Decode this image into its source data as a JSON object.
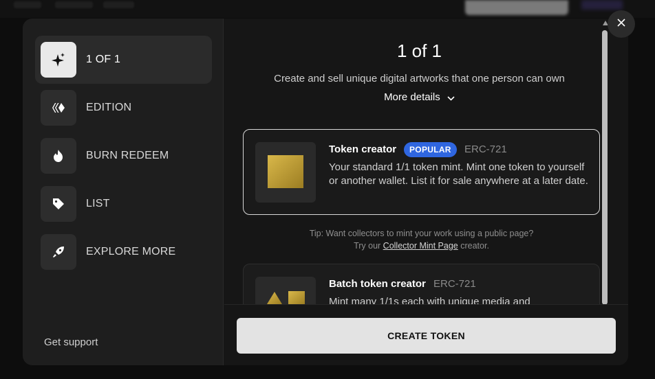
{
  "sidebar": {
    "items": [
      {
        "label": "1 OF 1",
        "icon": "sparkle-icon",
        "active": true
      },
      {
        "label": "EDITION",
        "icon": "edition-icon",
        "active": false
      },
      {
        "label": "BURN REDEEM",
        "icon": "fire-icon",
        "active": false
      },
      {
        "label": "LIST",
        "icon": "tag-icon",
        "active": false
      },
      {
        "label": "EXPLORE MORE",
        "icon": "rocket-icon",
        "active": false
      }
    ],
    "support_label": "Get support"
  },
  "main": {
    "title": "1 of 1",
    "subtitle": "Create and sell unique digital artworks that one person can own",
    "more_details": "More details",
    "cards": [
      {
        "title": "Token creator",
        "badge": "POPULAR",
        "standard": "ERC-721",
        "description": "Your standard 1/1 token mint. Mint one token to yourself or another wallet. List it for sale anywhere at a later date.",
        "selected": true
      },
      {
        "title": "Batch token creator",
        "standard": "ERC-721",
        "description": "Mint many 1/1s each with unique media and",
        "selected": false
      }
    ],
    "tip": {
      "prefix": "Tip: Want collectors to mint your work using a public page?",
      "try_our": "Try our",
      "link": "Collector Mint Page",
      "suffix": "creator."
    }
  },
  "footer": {
    "create_button": "CREATE TOKEN"
  },
  "colors": {
    "badge_blue": "#2f66e0",
    "gold": "#c9a83a",
    "button_bg": "#e3e3e3"
  }
}
